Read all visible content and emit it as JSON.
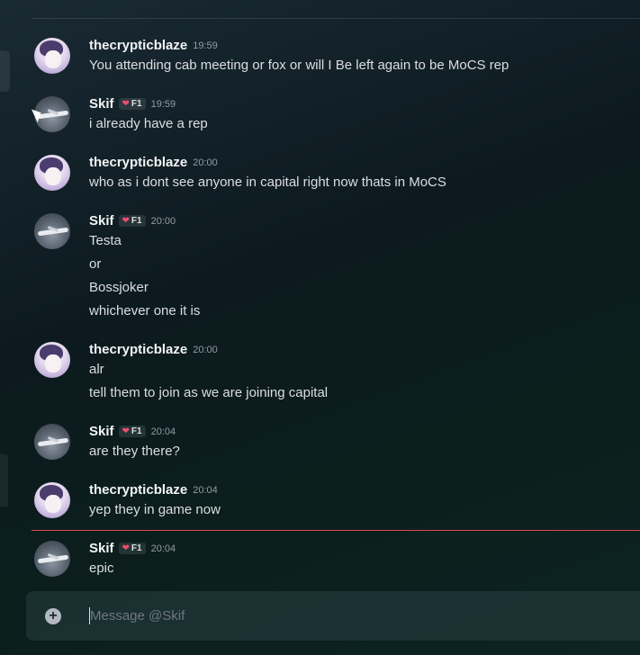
{
  "chat": {
    "messages": [
      {
        "author": "thecrypticblaze",
        "time": "19:59",
        "lines": [
          "You attending cab meeting or fox or will I Be left again to be MoCS rep"
        ]
      },
      {
        "author": "Skif",
        "badge": "F1",
        "time": "19:59",
        "lines": [
          "i already have a rep"
        ]
      },
      {
        "author": "thecrypticblaze",
        "time": "20:00",
        "lines": [
          "who as i dont see anyone in capital right now thats in MoCS"
        ]
      },
      {
        "author": "Skif",
        "badge": "F1",
        "time": "20:00",
        "lines": [
          "Testa",
          "or",
          "Bossjoker",
          "whichever one it is"
        ]
      },
      {
        "author": "thecrypticblaze",
        "time": "20:00",
        "lines": [
          "alr",
          "tell them to join as we are joining capital"
        ]
      },
      {
        "author": "Skif",
        "badge": "F1",
        "time": "20:04",
        "lines": [
          "are they there?"
        ]
      },
      {
        "author": "thecrypticblaze",
        "time": "20:04",
        "lines": [
          "yep they in game now"
        ]
      },
      {
        "author": "Skif",
        "badge": "F1",
        "time": "20:04",
        "lines": [
          "epic"
        ]
      }
    ]
  },
  "composer": {
    "placeholder": "Message @Skif",
    "add_icon": "plus-circle-icon"
  },
  "colors": {
    "new_divider": "#e0484e",
    "badge_heart": "#f04f6e"
  }
}
